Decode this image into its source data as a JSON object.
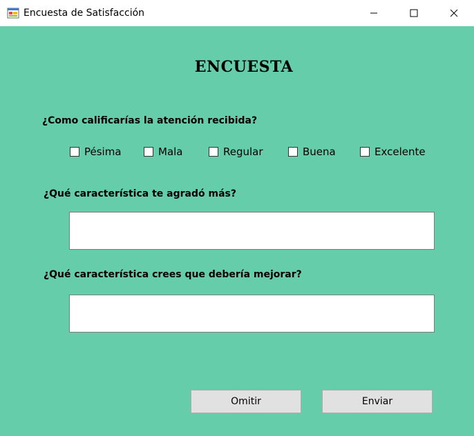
{
  "window": {
    "title": "Encuesta de Satisfacción",
    "icon": "form-app-icon",
    "controls": [
      "minimize-icon",
      "maximize-icon",
      "close-icon"
    ]
  },
  "survey": {
    "heading": "ENCUESTA",
    "question_rating": "¿Como calificarías la atención recibida?",
    "rating_options": [
      "Pésima",
      "Mala",
      "Regular",
      "Buena",
      "Excelente"
    ],
    "question_liked": "¿Qué característica te agradó más?",
    "liked_value": "",
    "question_improve": "¿Qué característica crees que debería mejorar?",
    "improve_value": ""
  },
  "buttons": {
    "omit": "Omitir",
    "send": "Enviar"
  },
  "colors": {
    "background": "#66CDAA",
    "titlebar": "#FFFFFF",
    "button": "#E1E1E1"
  }
}
